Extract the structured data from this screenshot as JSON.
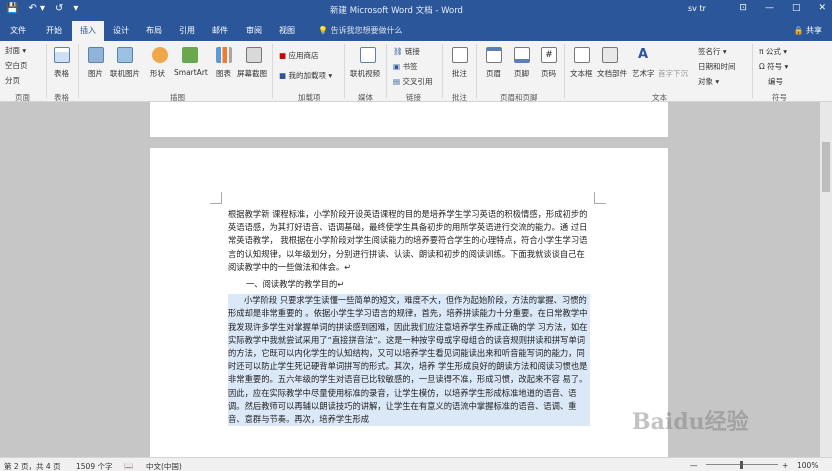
{
  "titlebar": {
    "qat": [
      "💾",
      "↶ ▾",
      "↺",
      "▾"
    ],
    "title": "新建 Microsoft Word 文档 - Word",
    "user": "sv tr",
    "controls": [
      "⊡",
      "—",
      "□",
      "✕"
    ]
  },
  "tabs": {
    "items": [
      "文件",
      "开始",
      "插入",
      "设计",
      "布局",
      "引用",
      "邮件",
      "审阅",
      "视图"
    ],
    "active": "插入",
    "tellme": "💡 告诉我您想要做什么",
    "share": "🔒 共享"
  },
  "ribbon": {
    "pages": [
      "封面 ▾",
      "空白页",
      "分页"
    ],
    "pages_group": "页面",
    "table": "表格",
    "table_group": "表格",
    "illustrations": [
      "图片",
      "联机图片",
      "形状",
      "SmartArt",
      "图表",
      "屏幕截图"
    ],
    "illustrations_group": "插图",
    "addins": [
      "应用商店",
      "我的加载项"
    ],
    "addins_group": "加载项",
    "media": "联机视频",
    "media_group": "媒体",
    "links": [
      "链接",
      "书签",
      "交叉引用"
    ],
    "links_group": "链接",
    "comment": "批注",
    "comment_group": "批注",
    "header_footer": [
      "页眉",
      "页脚",
      "页码"
    ],
    "header_footer_group": "页眉和页脚",
    "text": [
      "文本框",
      "文档部件",
      "艺术字",
      "首字下沉"
    ],
    "text_small": [
      "签名行 ▾",
      "日期和时间",
      "对象 ▾"
    ],
    "text_group": "文本",
    "symbols": [
      "π 公式 ▾",
      "Ω 符号 ▾",
      "编号"
    ],
    "symbols_group": "符号"
  },
  "document": {
    "para1": "根据教学新      课程标准，小学阶段开设英语课程的目的是培养学生学习英语的积极情感，形成初步的英语语感，为其打好语音、语调基础，最终使学生具备初步的用所学英语进行交流的能力。通         过日常英语教学，       我根据在小学阶段对学生阅读能力的培养要符合学生的心理特点，符合小学生学习语言的认知规律，以年级划分，分别进行拼读、认读、朗读和初步的阅读训练。下面我就谈谈自己在阅读教学中的一些做法和体会。↵",
    "heading": "一、阅读教学的教学目的↵",
    "para2": "小学阶段                只要求学生读懂一些简单的短文，难度不大，但作为起始阶段，方法的掌握、习惯的形成却是非常重要的                  。依据小学生学习语言的规律，首先，培养拼读能力十分重要。在日常教学中我发现许多学生对掌握单词的拼读感到困难，因此我们应注意培养学生养成正确的学           习方法，如在实际教学中我就尝试采用了“直接拼音法”。这是一种按字母或字母组合的读音规则拼读和拼写单词的方法，它既可以内化学生的认知结构，又可以培养学生看见词能读出来和听音能写词的能力，同时还可以防止学生死记硬背单词拼写的形式。其次，培养           学生形成良好的朗读方法和阅读习惯也是非常重要的。五六年级的学生对语音已比较敏感的，一旦读得不准，形成习惯，改起来不容            易了。因此，应在实际教学中尽量使用标准的录音，让学生模仿，以培养学生形成标准地道的语音、语调。然后教师可以再辅以朗读技巧的讲解，让学生在有意义的语流中掌握标准的语音、语调、重音、意群与节奏。再次，培养学生形成"
  },
  "status": {
    "page": "第 2 页，共 4 页",
    "words": "1509 个字",
    "proof": "📖",
    "lang": "中文(中国)",
    "zoom_minus": "—",
    "zoom_plus": "+",
    "zoom": "100%"
  },
  "watermark": "Baidu经验"
}
